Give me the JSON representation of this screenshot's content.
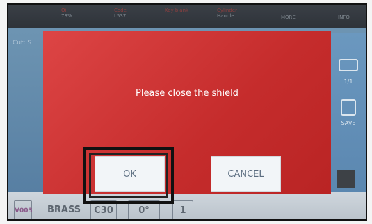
{
  "background_ui": {
    "topbar": [
      {
        "label": "Oil",
        "value": "73%"
      },
      {
        "label": "Code",
        "value": "L537"
      },
      {
        "label": "Key blank",
        "value": ""
      },
      {
        "label": "Cylinder",
        "value": "Handle"
      },
      {
        "label": "",
        "value": "MORE"
      },
      {
        "label": "",
        "value": "INFO"
      }
    ],
    "left_label": "Cut: S",
    "right_panel": {
      "item1_label": "1/1",
      "item2_label": "SAVE"
    },
    "bottombar": {
      "code": "V003",
      "material": "BRASS",
      "c_value": "C30",
      "angle": "0°",
      "count": "1"
    }
  },
  "dialog": {
    "message": "Please close the shield",
    "ok_label": "OK",
    "cancel_label": "CANCEL"
  },
  "colors": {
    "dialog_red": "#c52c2c",
    "button_bg": "#f2f5f8",
    "button_text": "#5b6d80",
    "screen_blue": "#6b98bf"
  }
}
